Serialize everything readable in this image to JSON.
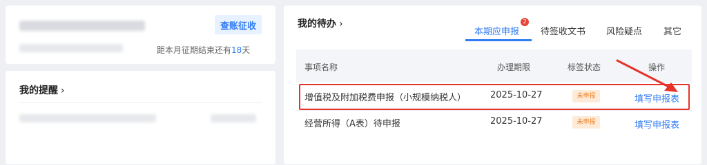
{
  "account": {
    "check_button": "查账征收",
    "deadline_prefix": "距本月征期结束还有",
    "deadline_days": "18",
    "deadline_suffix": "天"
  },
  "reminders": {
    "title": "我的提醒"
  },
  "todo": {
    "title": "我的待办",
    "tabs": [
      {
        "label": "本期应申报",
        "badge": "2"
      },
      {
        "label": "待签收文书"
      },
      {
        "label": "风险疑点"
      },
      {
        "label": "其它"
      }
    ],
    "columns": [
      "事项名称",
      "办理期限",
      "标签状态",
      "操作"
    ],
    "rows": [
      {
        "name": "增值税及附加税费申报（小规模纳税人）",
        "deadline": "2025-10-27",
        "status": "未申报",
        "action": "填写申报表"
      },
      {
        "name": "经营所得（A表）待申报",
        "deadline": "2025-10-27",
        "status": "未申报",
        "action": "填写申报表"
      }
    ]
  },
  "colors": {
    "accent": "#2f7bf5",
    "highlight": "#e5332a",
    "status_bg": "#fdebd8",
    "status_text": "#f07c1f"
  }
}
